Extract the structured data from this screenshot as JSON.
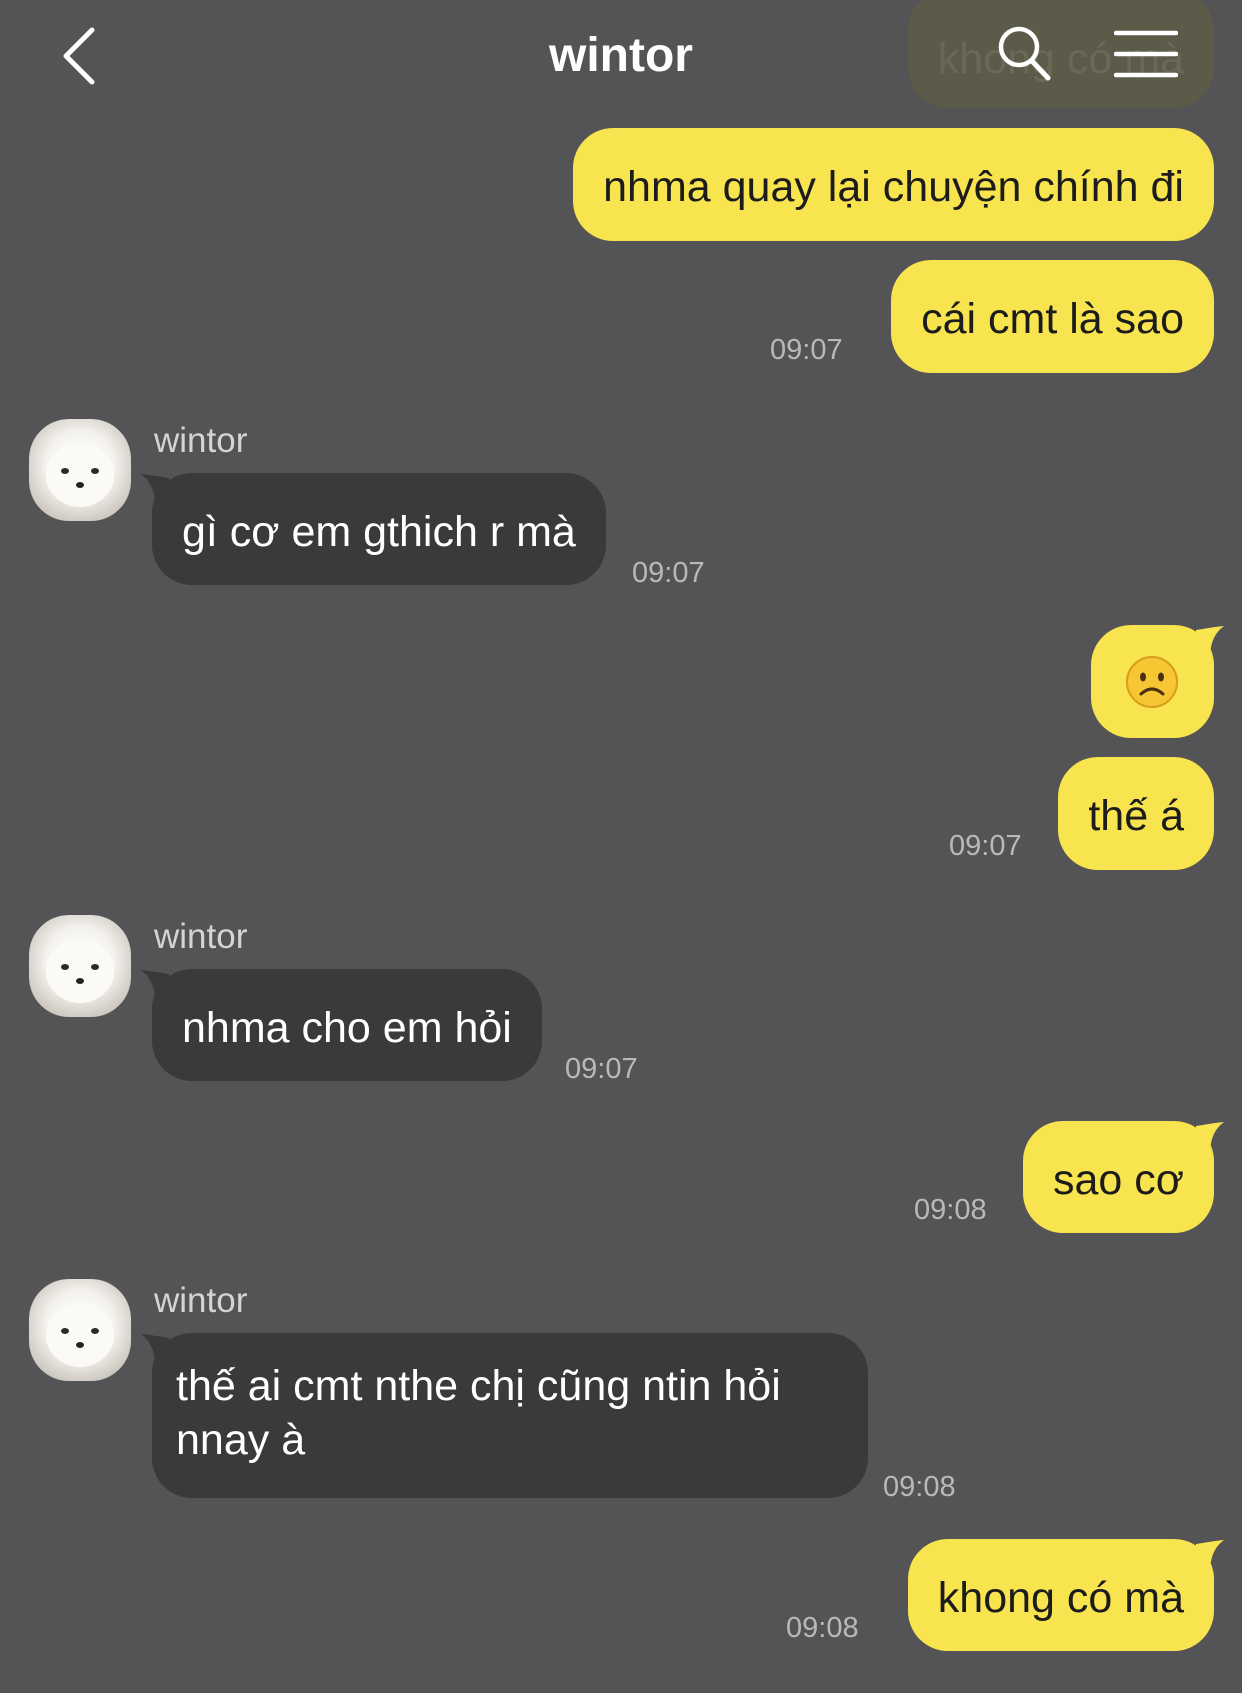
{
  "header": {
    "title": "wintor",
    "back_icon": "chevron-left-icon",
    "search_icon": "search-icon",
    "menu_icon": "menu-icon"
  },
  "colors": {
    "background": "#545355",
    "my_bubble": "#f8e44e",
    "their_bubble": "#3a393b"
  },
  "messages": [
    {
      "from": "me",
      "text": "khong có mà",
      "note": "partially hidden behind header"
    },
    {
      "from": "me",
      "text": "nhma quay lại chuyện chính đi"
    },
    {
      "from": "me",
      "text": "cái cmt là sao",
      "time": "09:07"
    },
    {
      "from": "wintor",
      "sender": "wintor",
      "text": "gì cơ em gthich r mà",
      "time": "09:07"
    },
    {
      "from": "me",
      "text": "☹️"
    },
    {
      "from": "me",
      "text": "thế á",
      "time": "09:07"
    },
    {
      "from": "wintor",
      "sender": "wintor",
      "text": "nhma cho em hỏi",
      "time": "09:07"
    },
    {
      "from": "me",
      "text": "sao cơ",
      "time": "09:08"
    },
    {
      "from": "wintor",
      "sender": "wintor",
      "text_line1": "thế ai cmt nthe chị cũng ntin hỏi",
      "text_line2": "nnay à",
      "time": "09:08"
    },
    {
      "from": "me",
      "text": "khong có mà",
      "time": "09:08"
    }
  ]
}
